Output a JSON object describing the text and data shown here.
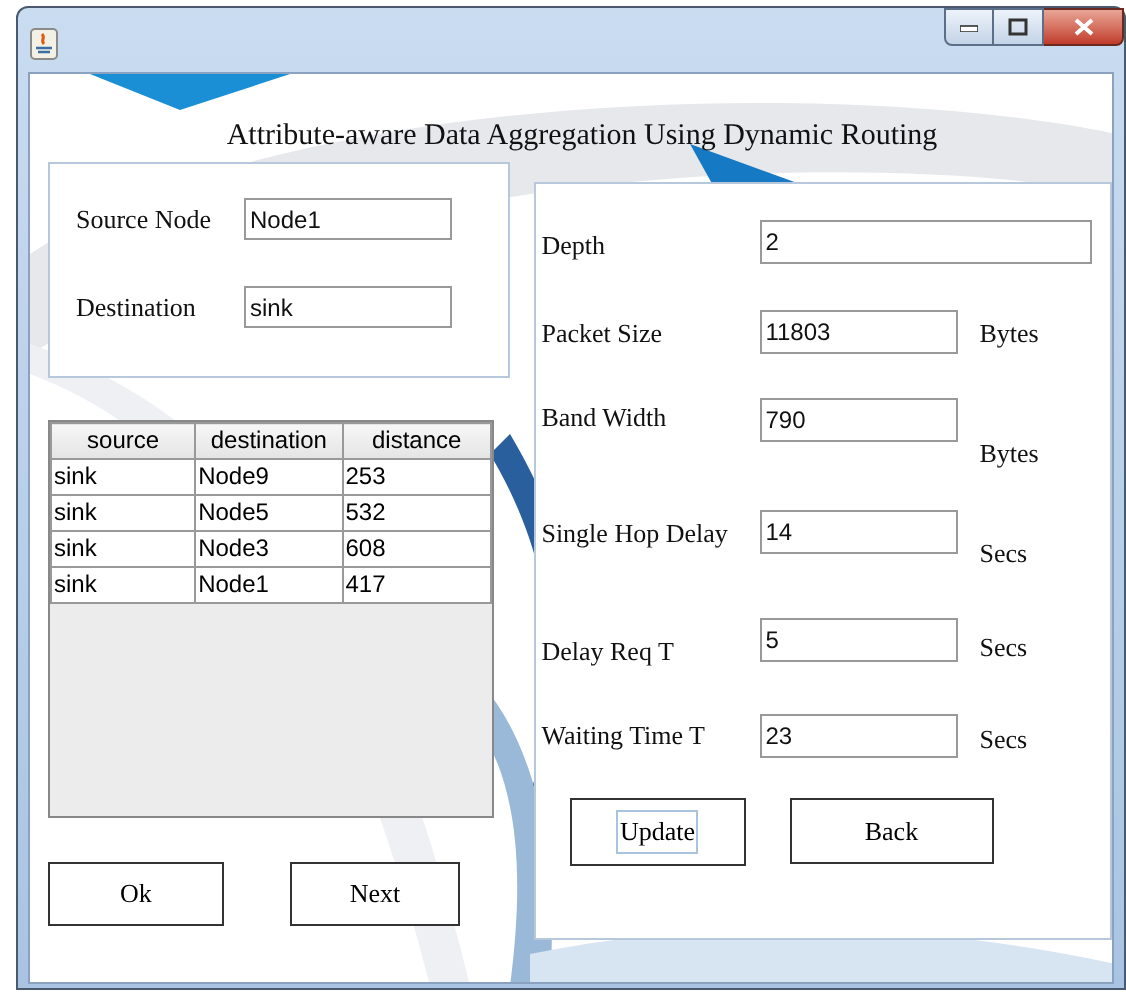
{
  "heading": "Attribute-aware Data Aggregation Using Dynamic Routing",
  "source_form": {
    "fields": [
      {
        "label": "Source Node",
        "value": "Node1"
      },
      {
        "label": "Destination",
        "value": "sink"
      }
    ]
  },
  "table": {
    "columns": [
      "source",
      "destination",
      "distance"
    ],
    "rows": [
      [
        "sink",
        "Node9",
        "253"
      ],
      [
        "sink",
        "Node5",
        "532"
      ],
      [
        "sink",
        "Node3",
        "608"
      ],
      [
        "sink",
        "Node1",
        "417"
      ]
    ]
  },
  "left_buttons": [
    {
      "label": "Ok"
    },
    {
      "label": "Next"
    }
  ],
  "parameters": [
    {
      "label": "Depth",
      "value": "2"
    },
    {
      "label": "Packet Size",
      "value": "11803",
      "unit": "Bytes"
    },
    {
      "label": "Band Width",
      "value": "790",
      "unit": "Bytes"
    },
    {
      "label": "Single Hop Delay",
      "value": "14",
      "unit": "Secs"
    },
    {
      "label": "Delay Req T",
      "value": "5",
      "unit": "Secs"
    },
    {
      "label": "Waiting Time T",
      "value": "23",
      "unit": "Secs"
    }
  ],
  "right_buttons": [
    {
      "label": "Update",
      "focused": true
    },
    {
      "label": "Back",
      "focused": false
    }
  ]
}
